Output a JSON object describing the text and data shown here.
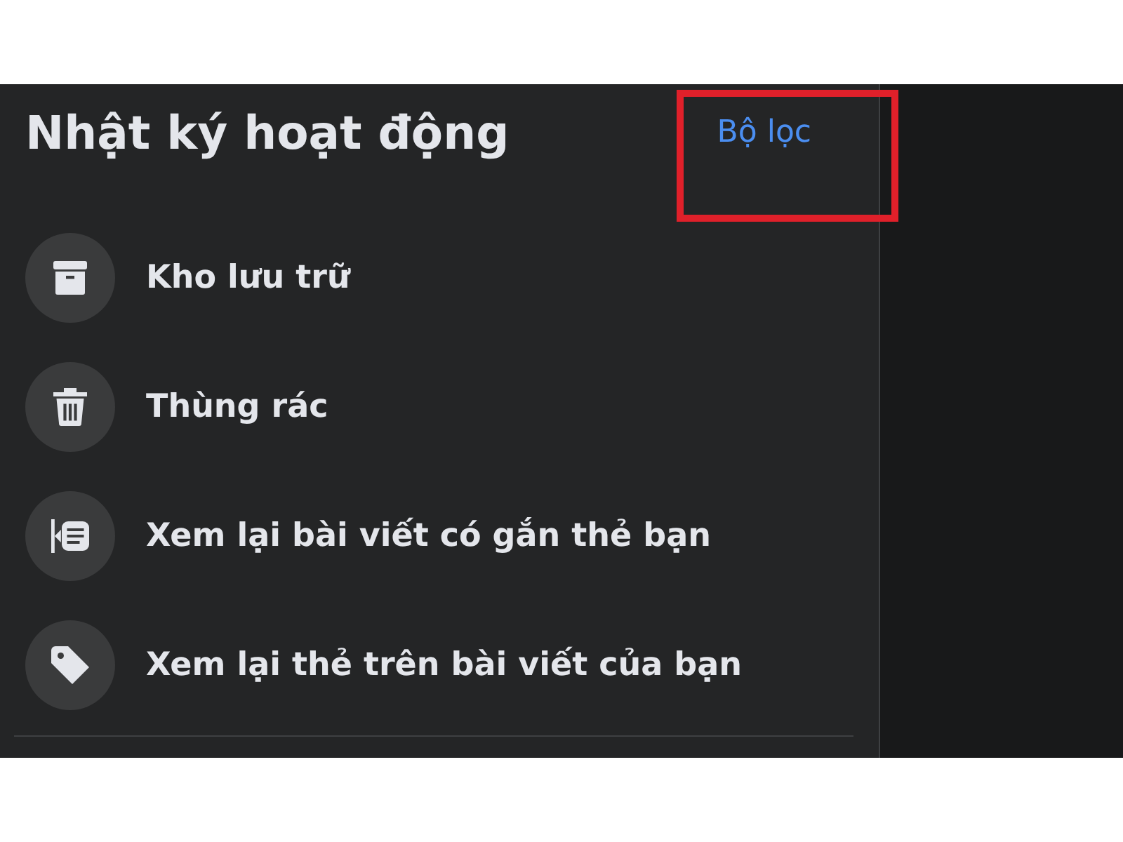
{
  "header": {
    "title": "Nhật ký hoạt động",
    "filter_link": "Bộ lọc"
  },
  "menu": [
    {
      "kind": "archive",
      "label": "Kho lưu trữ"
    },
    {
      "kind": "trash",
      "label": "Thùng rác"
    },
    {
      "kind": "tagged-posts",
      "label": "Xem lại bài viết có gắn thẻ bạn"
    },
    {
      "kind": "tag",
      "label": "Xem lại thẻ trên bài viết của bạn"
    }
  ]
}
